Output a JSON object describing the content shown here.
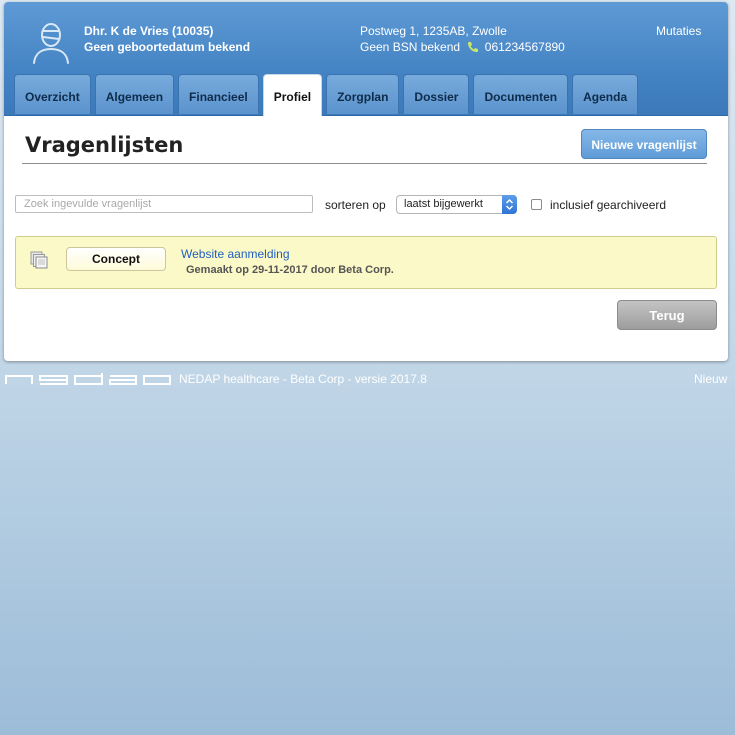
{
  "header": {
    "client_name": "Dhr. K de Vries (10035)",
    "birthdate": "Geen geboortedatum bekend",
    "address": "Postweg 1, 1235AB, Zwolle",
    "bsn": "Geen BSN bekend",
    "phone": "061234567890",
    "mutaties": "Mutaties"
  },
  "tabs": [
    {
      "label": "Overzicht"
    },
    {
      "label": "Algemeen"
    },
    {
      "label": "Financieel"
    },
    {
      "label": "Profiel",
      "active": true
    },
    {
      "label": "Zorgplan"
    },
    {
      "label": "Dossier"
    },
    {
      "label": "Documenten"
    },
    {
      "label": "Agenda"
    }
  ],
  "page": {
    "title": "Vragenlijsten",
    "new_button": "Nieuwe vragenlijst",
    "back_button": "Terug"
  },
  "filters": {
    "search_placeholder": "Zoek ingevulde vragenlijst",
    "sort_label": "sorteren op",
    "sort_value": "laatst bijgewerkt",
    "archived_label": "inclusief gearchiveerd",
    "archived_checked": false
  },
  "questionnaires": [
    {
      "status": "Concept",
      "name": "Website aanmelding",
      "meta": "Gemaakt op 29-11-2017 door Beta Corp."
    }
  ],
  "footer": {
    "logo_text": "nedap",
    "text": "NEDAP healthcare - Beta Corp - versie 2017.8",
    "new_link": "Nieuw"
  },
  "colors": {
    "header_blue": "#4584c4",
    "item_yellow": "#fbf9c7",
    "link_blue": "#1f5fbf"
  }
}
